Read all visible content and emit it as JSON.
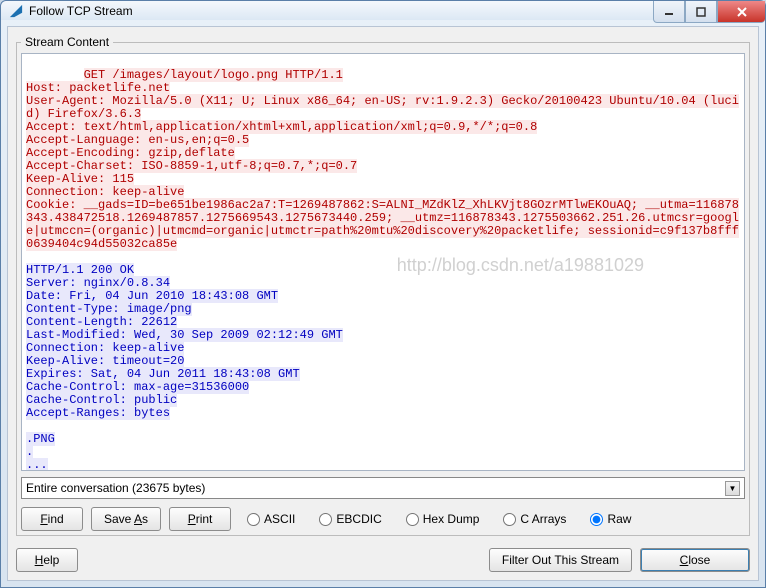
{
  "title": "Follow TCP Stream",
  "legend": "Stream Content",
  "request_lines": [
    "GET /images/layout/logo.png HTTP/1.1",
    "Host: packetlife.net",
    "User-Agent: Mozilla/5.0 (X11; U; Linux x86_64; en-US; rv:1.9.2.3) Gecko/20100423 Ubuntu/10.04 (lucid) Firefox/3.6.3",
    "Accept: text/html,application/xhtml+xml,application/xml;q=0.9,*/*;q=0.8",
    "Accept-Language: en-us,en;q=0.5",
    "Accept-Encoding: gzip,deflate",
    "Accept-Charset: ISO-8859-1,utf-8;q=0.7,*;q=0.7",
    "Keep-Alive: 115",
    "Connection: keep-alive",
    "Cookie: __gads=ID=be651be1986ac2a7:T=1269487862:S=ALNI_MZdKlZ_XhLKVjt8GOzrMTlwEKOuAQ; __utma=116878343.438472518.1269487857.1275669543.1275673440.259; __utmz=116878343.1275503662.251.26.utmcsr=google|utmccn=(organic)|utmcmd=organic|utmctr=path%20mtu%20discovery%20packetlife; sessionid=c9f137b8fff0639404c94d55032ca85e"
  ],
  "response_lines": [
    "HTTP/1.1 200 OK",
    "Server: nginx/0.8.34",
    "Date: Fri, 04 Jun 2010 18:43:08 GMT",
    "Content-Type: image/png",
    "Content-Length: 22612",
    "Last-Modified: Wed, 30 Sep 2009 02:12:49 GMT",
    "Connection: keep-alive",
    "Keep-Alive: timeout=20",
    "Expires: Sat, 04 Jun 2011 18:43:08 GMT",
    "Cache-Control: max-age=31536000",
    "Cache-Control: public",
    "Accept-Ranges: bytes",
    "",
    ".PNG",
    ".",
    "..."
  ],
  "watermark": "http://blog.csdn.net/a19881029",
  "dropdown_selected": "Entire conversation (23675 bytes)",
  "buttons": {
    "find": "Find",
    "save_as": "Save As",
    "print": "Print",
    "help": "Help",
    "filter_out": "Filter Out This Stream",
    "close": "Close"
  },
  "radios": {
    "ascii": "ASCII",
    "ebcdic": "EBCDIC",
    "hexdump": "Hex Dump",
    "carrays": "C Arrays",
    "raw": "Raw"
  },
  "selected_radio": "raw",
  "underline": {
    "find": "F",
    "save_as": "A",
    "print": "P",
    "help": "H",
    "close": "C"
  }
}
